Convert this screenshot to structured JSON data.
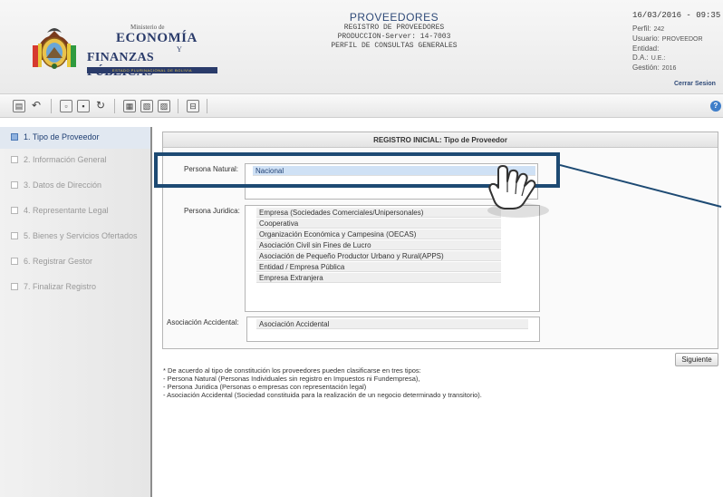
{
  "header": {
    "logo": {
      "ministerio": "Ministerio de",
      "economia": "ECONOMÍA",
      "y": "Y",
      "finanzas": "FINANZAS PÚBLICAS",
      "estado": "ESTADO PLURINACIONAL DE BOLIVIA"
    },
    "title": "PROVEEDORES",
    "subtitle1": "REGISTRO DE PROVEEDORES",
    "subtitle2": "PRODUCCION-Server: 14-7003",
    "subtitle3": "PERFIL DE CONSULTAS GENERALES",
    "datetime": "16/03/2016 - 09:35",
    "perfil_label": "Perfil:",
    "perfil_value": "242",
    "usuario_label": "Usuario:",
    "usuario_value": "PROVEEDOR",
    "entidad_label": "Entidad:",
    "da_label": "D.A.:",
    "ue_label": "U.E.:",
    "gestion_label": "Gestión:",
    "gestion_value": "2016",
    "cerrar_sesion": "Cerrar Sesion"
  },
  "toolbar": {
    "help_label": "?"
  },
  "sidebar": {
    "items": [
      {
        "label": "1. Tipo de Proveedor",
        "active": true
      },
      {
        "label": "2. Información General",
        "active": false
      },
      {
        "label": "3. Datos de Dirección",
        "active": false
      },
      {
        "label": "4. Representante Legal",
        "active": false
      },
      {
        "label": "5. Bienes y Servicios Ofertados",
        "active": false
      },
      {
        "label": "6. Registrar Gestor",
        "active": false
      },
      {
        "label": "7. Finalizar Registro",
        "active": false
      }
    ]
  },
  "form": {
    "title": "REGISTRO INICIAL: Tipo de Proveedor",
    "natural_label": "Persona Natural:",
    "natural_options": [
      "Nacional"
    ],
    "juridica_label": "Persona Juridica:",
    "juridica_options": [
      "Empresa (Sociedades Comerciales/Unipersonales)",
      "Cooperativa",
      "Organización Económica y Campesina (OECAS)",
      "Asociación Civil sin Fines de Lucro",
      "Asociación de Pequeño Productor Urbano y Rural(APPS)",
      "Entidad / Empresa Pública",
      "Empresa Extranjera"
    ],
    "accidental_label": "Asociación Accidental:",
    "accidental_options": [
      "Asociación Accidental"
    ],
    "next_button": "Siguiente"
  },
  "notes": [
    "* De acuerdo al tipo de constitución los proveedores pueden clasificarse en tres tipos:",
    "- Persona Natural (Personas Individuales sin registro en Impuestos ni Fundempresa),",
    "- Persona Juridica (Personas o empresas con representación legal)",
    "- Asociación Accidental (Sociedad constituida para la realización de un negocio determinado y transitorio)."
  ],
  "colors": {
    "brand": "#2a3b6a",
    "highlight": "#1d4a73",
    "selected": "#cfe1f5"
  }
}
